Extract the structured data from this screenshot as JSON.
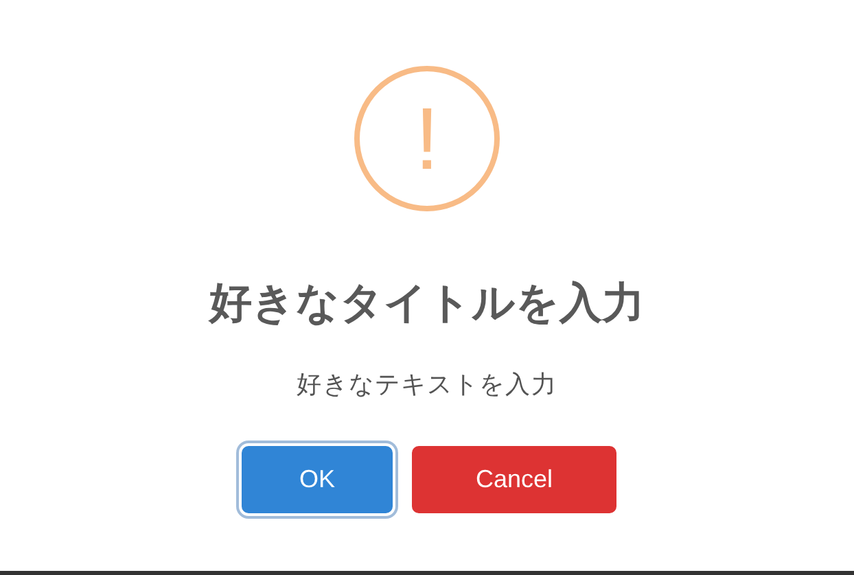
{
  "dialog": {
    "icon": {
      "kind": "warning",
      "symbol": "!"
    },
    "title": "好きなタイトルを入力",
    "text": "好きなテキストを入力",
    "buttons": [
      {
        "label": "OK",
        "kind": "confirm",
        "focused": true
      },
      {
        "label": "Cancel",
        "kind": "cancel",
        "focused": false
      }
    ]
  }
}
